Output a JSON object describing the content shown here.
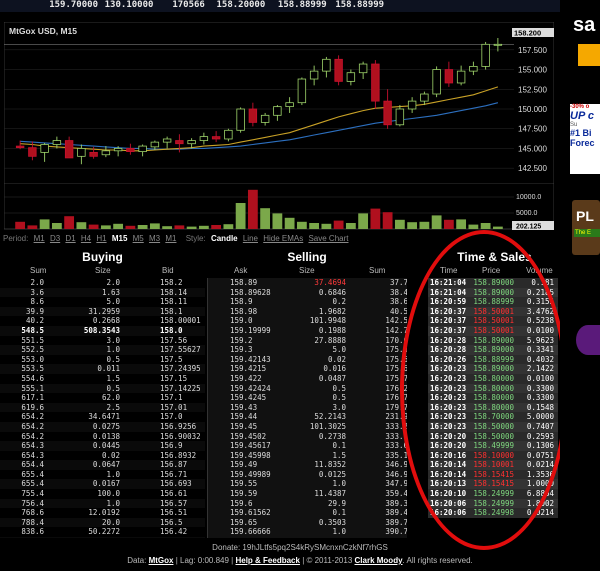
{
  "ticker": [
    "159.70000",
    "130.10000",
    "170566",
    "158.20000",
    "158.88999",
    "158.88999"
  ],
  "chart": {
    "title": "MtGox USD, M15",
    "yticks": [
      "157.500",
      "155.000",
      "152.500",
      "150.000",
      "147.500",
      "145.000",
      "142.500"
    ],
    "current_label": "158.200",
    "volume_ticks": [
      "10000.0",
      "5000.0"
    ],
    "volume_current": "202.125"
  },
  "chart_data": {
    "type": "candlestick",
    "title": "MtGox USD, M15",
    "ylim": [
      141,
      159
    ],
    "candles": [
      {
        "o": 145.3,
        "h": 146.0,
        "l": 144.9,
        "c": 145.1
      },
      {
        "o": 145.1,
        "h": 145.9,
        "l": 143.5,
        "c": 144.0
      },
      {
        "o": 144.5,
        "h": 145.7,
        "l": 143.3,
        "c": 145.5
      },
      {
        "o": 145.5,
        "h": 146.5,
        "l": 145.0,
        "c": 146.0
      },
      {
        "o": 146.0,
        "h": 146.5,
        "l": 143.8,
        "c": 143.8
      },
      {
        "o": 144.0,
        "h": 145.5,
        "l": 143.0,
        "c": 145.0
      },
      {
        "o": 144.5,
        "h": 145.2,
        "l": 143.7,
        "c": 144.0
      },
      {
        "o": 144.2,
        "h": 145.3,
        "l": 143.9,
        "c": 144.7
      },
      {
        "o": 144.7,
        "h": 145.3,
        "l": 144.0,
        "c": 145.0
      },
      {
        "o": 145.0,
        "h": 145.6,
        "l": 144.2,
        "c": 144.6
      },
      {
        "o": 144.6,
        "h": 145.5,
        "l": 144.0,
        "c": 145.3
      },
      {
        "o": 145.2,
        "h": 146.0,
        "l": 144.8,
        "c": 145.8
      },
      {
        "o": 145.8,
        "h": 146.5,
        "l": 145.0,
        "c": 146.2
      },
      {
        "o": 146.0,
        "h": 146.8,
        "l": 144.5,
        "c": 145.6
      },
      {
        "o": 145.6,
        "h": 146.3,
        "l": 145.0,
        "c": 146.0
      },
      {
        "o": 146.0,
        "h": 147.0,
        "l": 145.5,
        "c": 146.5
      },
      {
        "o": 146.5,
        "h": 147.2,
        "l": 145.8,
        "c": 146.2
      },
      {
        "o": 146.2,
        "h": 147.5,
        "l": 145.9,
        "c": 147.3
      },
      {
        "o": 147.3,
        "h": 150.2,
        "l": 147.0,
        "c": 150.0
      },
      {
        "o": 150.0,
        "h": 150.8,
        "l": 147.8,
        "c": 148.3
      },
      {
        "o": 148.3,
        "h": 149.5,
        "l": 147.9,
        "c": 149.2
      },
      {
        "o": 149.2,
        "h": 150.5,
        "l": 148.5,
        "c": 150.3
      },
      {
        "o": 150.3,
        "h": 151.5,
        "l": 149.5,
        "c": 150.8
      },
      {
        "o": 150.8,
        "h": 154.0,
        "l": 150.5,
        "c": 153.8
      },
      {
        "o": 153.8,
        "h": 155.5,
        "l": 153.0,
        "c": 154.8
      },
      {
        "o": 154.8,
        "h": 156.6,
        "l": 154.0,
        "c": 156.3
      },
      {
        "o": 156.3,
        "h": 156.8,
        "l": 153.0,
        "c": 153.5
      },
      {
        "o": 153.5,
        "h": 155.0,
        "l": 153.0,
        "c": 154.6
      },
      {
        "o": 154.6,
        "h": 156.0,
        "l": 153.8,
        "c": 155.7
      },
      {
        "o": 155.7,
        "h": 156.2,
        "l": 150.0,
        "c": 151.0
      },
      {
        "o": 151.0,
        "h": 152.5,
        "l": 147.5,
        "c": 148.0
      },
      {
        "o": 148.0,
        "h": 150.5,
        "l": 147.8,
        "c": 150.0
      },
      {
        "o": 150.0,
        "h": 151.5,
        "l": 149.5,
        "c": 151.0
      },
      {
        "o": 151.0,
        "h": 152.2,
        "l": 150.5,
        "c": 151.9
      },
      {
        "o": 151.9,
        "h": 155.4,
        "l": 151.5,
        "c": 155.0
      },
      {
        "o": 155.0,
        "h": 156.0,
        "l": 152.8,
        "c": 153.3
      },
      {
        "o": 153.3,
        "h": 155.5,
        "l": 153.0,
        "c": 154.8
      },
      {
        "o": 154.8,
        "h": 156.0,
        "l": 154.3,
        "c": 155.4
      },
      {
        "o": 155.4,
        "h": 158.5,
        "l": 155.0,
        "c": 158.2
      },
      {
        "o": 158.2,
        "h": 159.0,
        "l": 157.3,
        "c": 158.2
      }
    ],
    "volumes": [
      1800,
      900,
      2400,
      1500,
      3200,
      1700,
      1100,
      900,
      1300,
      800,
      1000,
      1400,
      700,
      900,
      600,
      800,
      1000,
      1200,
      6500,
      9800,
      5200,
      3900,
      2800,
      1800,
      1500,
      1300,
      2100,
      1500,
      3900,
      5100,
      4200,
      2300,
      1700,
      1800,
      3400,
      2300,
      2400,
      1100,
      1500,
      600
    ],
    "ma_yellow": [
      145.6,
      145.5,
      145.3,
      145.2,
      145.1,
      145.0,
      144.9,
      144.8,
      144.8,
      144.7,
      144.7,
      144.8,
      144.9,
      145.0,
      145.1,
      145.3,
      145.4,
      145.5,
      145.8,
      146.1,
      146.4,
      146.7,
      147.0,
      147.5,
      148.0,
      148.5,
      149.0,
      149.4,
      149.8,
      150.1,
      150.2,
      150.3,
      150.4,
      150.6,
      150.9,
      151.2,
      151.5,
      151.8,
      152.3,
      152.8
    ],
    "ma_blue": [
      145.9,
      145.8,
      145.7,
      145.6,
      145.5,
      145.4,
      145.3,
      145.2,
      145.1,
      145.0,
      145.0,
      144.9,
      144.9,
      144.9,
      145.0,
      145.0,
      145.1,
      145.2,
      145.3,
      145.5,
      145.7,
      145.9,
      146.1,
      146.4,
      146.7,
      147.0,
      147.3,
      147.6,
      147.9,
      148.2,
      148.4,
      148.6,
      148.8,
      149.0,
      149.2,
      149.5,
      149.8,
      150.1,
      150.4,
      150.8
    ]
  },
  "periods": {
    "label": "Period:",
    "items": [
      "M1",
      "D3",
      "D1",
      "H4",
      "H1",
      "M15",
      "M5",
      "M3",
      "M1"
    ],
    "selected": "M15",
    "style_label": "Style:",
    "styles": [
      "Candle",
      "Line"
    ],
    "selected_style": "Candle",
    "hide": "Hide EMAs",
    "save": "Save Chart"
  },
  "buying": {
    "title": "Buying",
    "headers": [
      "Sum",
      "Size",
      "Bid"
    ],
    "rows": [
      [
        "2.0",
        "2.0",
        "158.2"
      ],
      [
        "3.6",
        "1.63",
        "158.14"
      ],
      [
        "8.6",
        "5.0",
        "158.11"
      ],
      [
        "39.9",
        "31.2959",
        "158.1"
      ],
      [
        "40.2",
        "0.2668",
        "158.00001"
      ],
      [
        "548.5",
        "508.3543",
        "158.0"
      ],
      [
        "551.5",
        "3.0",
        "157.56"
      ],
      [
        "552.5",
        "1.0",
        "157.55627"
      ],
      [
        "553.0",
        "0.5",
        "157.5"
      ],
      [
        "553.5",
        "0.011",
        "157.24395"
      ],
      [
        "554.6",
        "1.5",
        "157.15"
      ],
      [
        "555.1",
        "0.5",
        "157.14225"
      ],
      [
        "617.1",
        "62.0",
        "157.1"
      ],
      [
        "619.6",
        "2.5",
        "157.01"
      ],
      [
        "654.2",
        "34.6471",
        "157.0"
      ],
      [
        "654.2",
        "0.0275",
        "156.9256"
      ],
      [
        "654.2",
        "0.0138",
        "156.90032"
      ],
      [
        "654.3",
        "0.0445",
        "156.9"
      ],
      [
        "654.3",
        "0.02",
        "156.8932"
      ],
      [
        "654.4",
        "0.0647",
        "156.87"
      ],
      [
        "655.4",
        "1.0",
        "156.71"
      ],
      [
        "655.4",
        "0.0167",
        "156.693"
      ],
      [
        "755.4",
        "100.0",
        "156.61"
      ],
      [
        "756.4",
        "1.0",
        "156.57"
      ],
      [
        "768.6",
        "12.0192",
        "156.51"
      ],
      [
        "788.4",
        "20.0",
        "156.5"
      ],
      [
        "838.6",
        "50.2272",
        "156.42"
      ],
      [
        "839.6",
        "1.0",
        "156.41002"
      ],
      [
        "939.6",
        "100.0",
        "156.41"
      ],
      [
        "940.5",
        "0.8396",
        "156.30447"
      ]
    ],
    "bold_index": 5
  },
  "selling": {
    "title": "Selling",
    "headers": [
      "Ask",
      "Size",
      "Sum"
    ],
    "rows": [
      [
        "158.89",
        "37.4694",
        "37.7"
      ],
      [
        "158.89628",
        "0.6846",
        "38.4"
      ],
      [
        "158.9",
        "0.2",
        "38.6"
      ],
      [
        "158.98",
        "1.9682",
        "40.5"
      ],
      [
        "159.0",
        "101.9948",
        "142.5"
      ],
      [
        "159.19999",
        "0.1988",
        "142.7"
      ],
      [
        "159.2",
        "27.8888",
        "170.6"
      ],
      [
        "159.3",
        "5.0",
        "175.6"
      ],
      [
        "159.42143",
        "0.02",
        "175.6"
      ],
      [
        "159.4215",
        "0.016",
        "175.6"
      ],
      [
        "159.422",
        "0.0487",
        "175.7"
      ],
      [
        "159.42424",
        "0.5",
        "176.2"
      ],
      [
        "159.4245",
        "0.5",
        "176.7"
      ],
      [
        "159.43",
        "3.0",
        "179.7"
      ],
      [
        "159.44",
        "52.2143",
        "231.9"
      ],
      [
        "159.45",
        "101.3025",
        "333.2"
      ],
      [
        "159.4502",
        "0.2738",
        "333.5"
      ],
      [
        "159.45617",
        "0.1",
        "333.6"
      ],
      [
        "159.45998",
        "1.5",
        "335.1"
      ],
      [
        "159.49",
        "11.8352",
        "346.9"
      ],
      [
        "159.49989",
        "0.0125",
        "346.9"
      ],
      [
        "159.55",
        "1.0",
        "347.9"
      ],
      [
        "159.59",
        "11.4387",
        "359.4"
      ],
      [
        "159.6",
        "29.9",
        "389.3"
      ],
      [
        "159.61562",
        "0.1",
        "389.4"
      ],
      [
        "159.65",
        "0.3503",
        "389.7"
      ],
      [
        "159.66666",
        "1.0",
        "390.7"
      ],
      [
        "159.67979",
        "0.4345",
        "391.2"
      ],
      [
        "159.6801",
        "8.5",
        "399.7"
      ],
      [
        "159.69",
        "1.0",
        "400.7"
      ]
    ],
    "red_index": 0
  },
  "ts": {
    "title": "Time & Sales",
    "headers": [
      "Time",
      "Price",
      "Volume"
    ],
    "rows": [
      [
        "16:21:04",
        "158.89000",
        "0.181",
        "g"
      ],
      [
        "16:21:04",
        "158.89000",
        "0.2185",
        "g"
      ],
      [
        "16:20:59",
        "158.88999",
        "0.3155",
        "g"
      ],
      [
        "16:20:37",
        "158.50001",
        "3.4762",
        "r"
      ],
      [
        "16:20:37",
        "158.50001",
        "0.5238",
        "r"
      ],
      [
        "16:20:37",
        "158.50001",
        "0.0100",
        "r"
      ],
      [
        "16:20:28",
        "158.89000",
        "5.9623",
        "g"
      ],
      [
        "16:20:28",
        "158.89000",
        "0.3341",
        "g"
      ],
      [
        "16:20:26",
        "158.88999",
        "0.4032",
        "g"
      ],
      [
        "16:20:23",
        "158.89000",
        "2.1422",
        "g"
      ],
      [
        "16:20:23",
        "158.80000",
        "0.0100",
        "g"
      ],
      [
        "16:20:23",
        "158.80000",
        "0.3300",
        "g"
      ],
      [
        "16:20:23",
        "158.80000",
        "0.3300",
        "g"
      ],
      [
        "16:20:23",
        "158.80000",
        "0.1548",
        "g"
      ],
      [
        "16:20:23",
        "158.70000",
        "5.0000",
        "g"
      ],
      [
        "16:20:23",
        "158.50000",
        "0.7407",
        "g"
      ],
      [
        "16:20:20",
        "158.50000",
        "0.2593",
        "g"
      ],
      [
        "16:20:20",
        "158.49999",
        "0.1306",
        "g"
      ],
      [
        "16:20:16",
        "158.10000",
        "0.0751",
        "r"
      ],
      [
        "16:20:14",
        "158.10001",
        "0.0214",
        "r"
      ],
      [
        "16:20:14",
        "158.15415",
        "1.3536",
        "r"
      ],
      [
        "16:20:13",
        "158.15415",
        "1.0000",
        "r"
      ],
      [
        "16:20:10",
        "158.24999",
        "6.8864",
        "g"
      ],
      [
        "16:20:06",
        "158.24999",
        "1.8002",
        "g"
      ],
      [
        "16:20:06",
        "158.24998",
        "0.0214",
        "g"
      ]
    ]
  },
  "footer": {
    "donate": "Donate: 19hJLtfs5pq2S4kRySMcnxnCzkNf7rhGS",
    "data_label": "Data:",
    "source": "MtGox",
    "lag": "| Lag: 0:00.849 |",
    "help": "Help & Feedback",
    "copyright": "| © 2011-2013",
    "author": "Clark Moody",
    "rights": ". All rights reserved."
  },
  "ads": {
    "sa": "sa",
    "promo": "-30% o",
    "up": "UP c",
    "su": "Su",
    "bi": "#1 Bi",
    "fore": "Forec",
    "pl": "PL",
    "the": "The E"
  }
}
